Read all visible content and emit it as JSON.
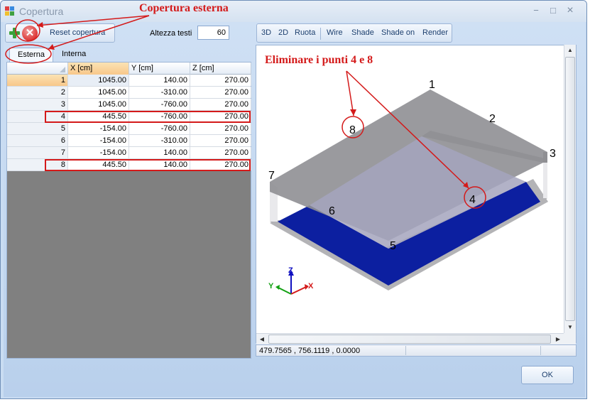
{
  "window": {
    "title": "Copertura",
    "minimize_glyph": "−",
    "maximize_glyph": "□",
    "close_glyph": "×"
  },
  "toolbar": {
    "reset_label": "Reset copertura",
    "altezza_label": "Altezza testi",
    "altezza_value": "60"
  },
  "tabs": [
    {
      "label": "Esterna",
      "active": true
    },
    {
      "label": "Interna",
      "active": false
    }
  ],
  "table": {
    "columns": [
      "X [cm]",
      "Y [cm]",
      "Z [cm]"
    ],
    "rows": [
      {
        "n": "1",
        "x": "1045.00",
        "y": "140.00",
        "z": "270.00"
      },
      {
        "n": "2",
        "x": "1045.00",
        "y": "-310.00",
        "z": "270.00"
      },
      {
        "n": "3",
        "x": "1045.00",
        "y": "-760.00",
        "z": "270.00"
      },
      {
        "n": "4",
        "x": "445.50",
        "y": "-760.00",
        "z": "270.00"
      },
      {
        "n": "5",
        "x": "-154.00",
        "y": "-760.00",
        "z": "270.00"
      },
      {
        "n": "6",
        "x": "-154.00",
        "y": "-310.00",
        "z": "270.00"
      },
      {
        "n": "7",
        "x": "-154.00",
        "y": "140.00",
        "z": "270.00"
      },
      {
        "n": "8",
        "x": "445.50",
        "y": "140.00",
        "z": "270.00"
      }
    ]
  },
  "view_toolbar": {
    "buttons": [
      "3D",
      "2D",
      "Ruota",
      "Wire",
      "Shade",
      "Shade on",
      "Render"
    ]
  },
  "viewport": {
    "point_labels": [
      "1",
      "2",
      "3",
      "4",
      "5",
      "6",
      "7",
      "8"
    ],
    "axis_labels": {
      "x": "X",
      "y": "Y",
      "z": "Z"
    }
  },
  "status": {
    "coords": "479.7565 , 756.1119 , 0.0000"
  },
  "ok_label": "OK",
  "annotations": {
    "copertura": "Copertura esterna",
    "eliminare": "Eliminare i punti 4 e 8"
  },
  "colors": {
    "annotation_red": "#d41a1a",
    "floor_blue": "#0c1fa0",
    "roof_grey": "#a3a3a6"
  }
}
